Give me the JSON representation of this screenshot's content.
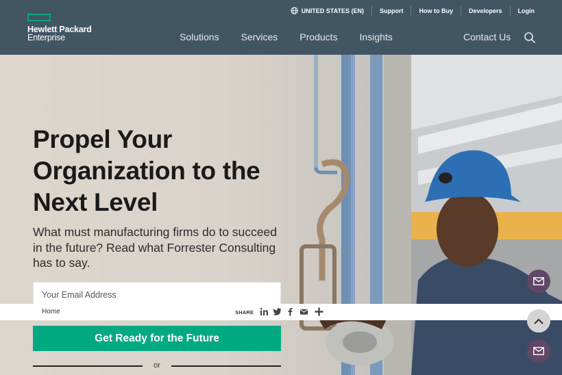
{
  "brand": {
    "line1": "Hewlett Packard",
    "line2": "Enterprise",
    "accent": "#01a982",
    "header_bg": "#425563"
  },
  "utility_nav": {
    "region": "UNITED STATES (EN)",
    "region_icon": "globe-icon",
    "items": [
      "Support",
      "How to Buy",
      "Developers",
      "Login"
    ]
  },
  "main_nav": {
    "items": [
      "Solutions",
      "Services",
      "Products",
      "Insights"
    ],
    "contact": "Contact Us",
    "search_icon": "search-icon"
  },
  "hero": {
    "headline": "Propel Your Organization to the Next Level",
    "subhead": "What must manufacturing firms do to succeed in the future? Read what Forrester Consulting has to say.",
    "email_placeholder": "Your Email Address",
    "email_value": "",
    "cta_label": "Get Ready for the Future",
    "or_label": "or"
  },
  "share_bar": {
    "breadcrumb": "Home",
    "share_label": "SHARE",
    "icons": [
      "linkedin-icon",
      "twitter-icon",
      "facebook-icon",
      "email-icon",
      "plus-icon"
    ]
  },
  "floating_buttons": [
    "mail-icon",
    "chevron-up-icon",
    "mail-icon"
  ]
}
